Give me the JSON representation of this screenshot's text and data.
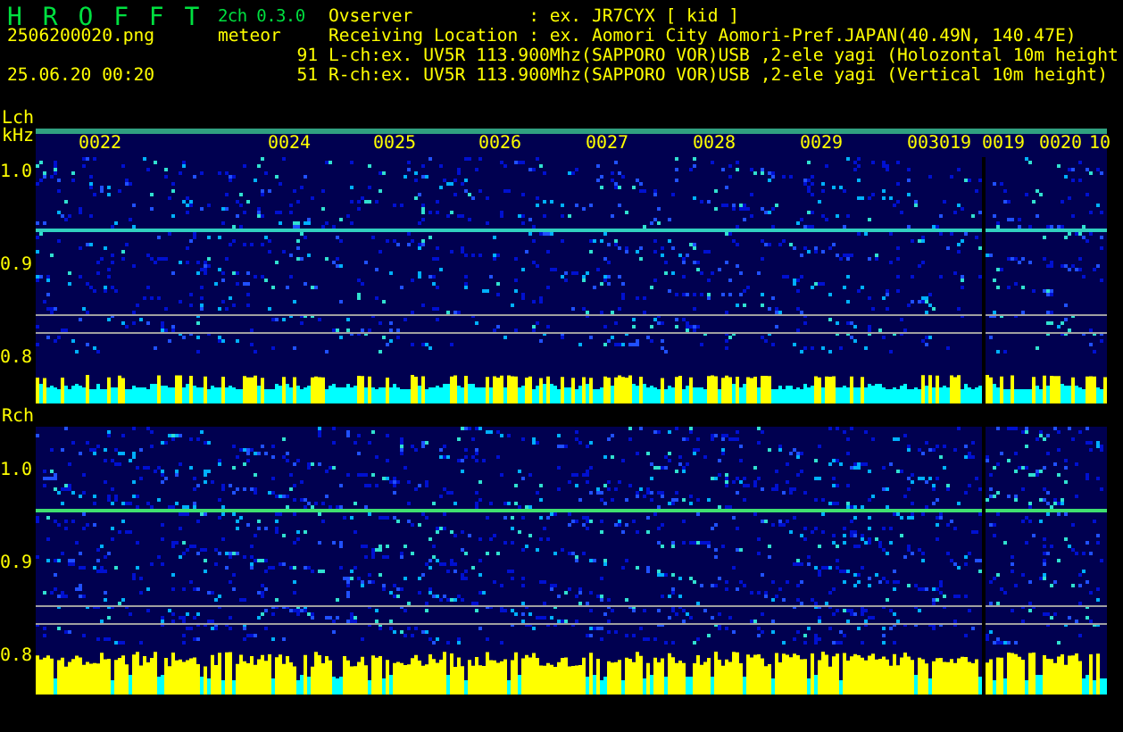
{
  "header": {
    "title": "H R O F F T",
    "version": "2ch 0.3.0",
    "mode": "meteor",
    "filename": "2506200020.png",
    "datetime": "25.06.20 00:20",
    "lch_count": "91",
    "rch_count": "51",
    "observer": {
      "label": "Ovserver",
      "value": ": ex. JR7CYX [ kid ]"
    },
    "location": {
      "label": "Receiving Location",
      "value": ": ex. Aomori City Aomori-Pref.JAPAN(40.49N, 140.47E)"
    },
    "lch_info": "L-ch:ex. UV5R 113.900Mhz(SAPPORO VOR)USB ,2-ele yagi (Holozontal 10m height",
    "rch_info": "R-ch:ex. UV5R 113.900Mhz(SAPPORO VOR)USB ,2-ele yagi (Vertical 10m height)"
  },
  "panels": [
    {
      "channel": "Lch",
      "unit": "kHz",
      "ticks": [
        "1.0",
        "0.9",
        "0.8"
      ],
      "time_labels": [
        "0022",
        "0024",
        "0025",
        "0026",
        "0027",
        "0028",
        "0029",
        "0030",
        "19",
        "0019",
        "0020",
        "10"
      ]
    },
    {
      "channel": "Rch",
      "ticks": [
        "1.0",
        "0.9",
        "0.8"
      ]
    }
  ]
}
